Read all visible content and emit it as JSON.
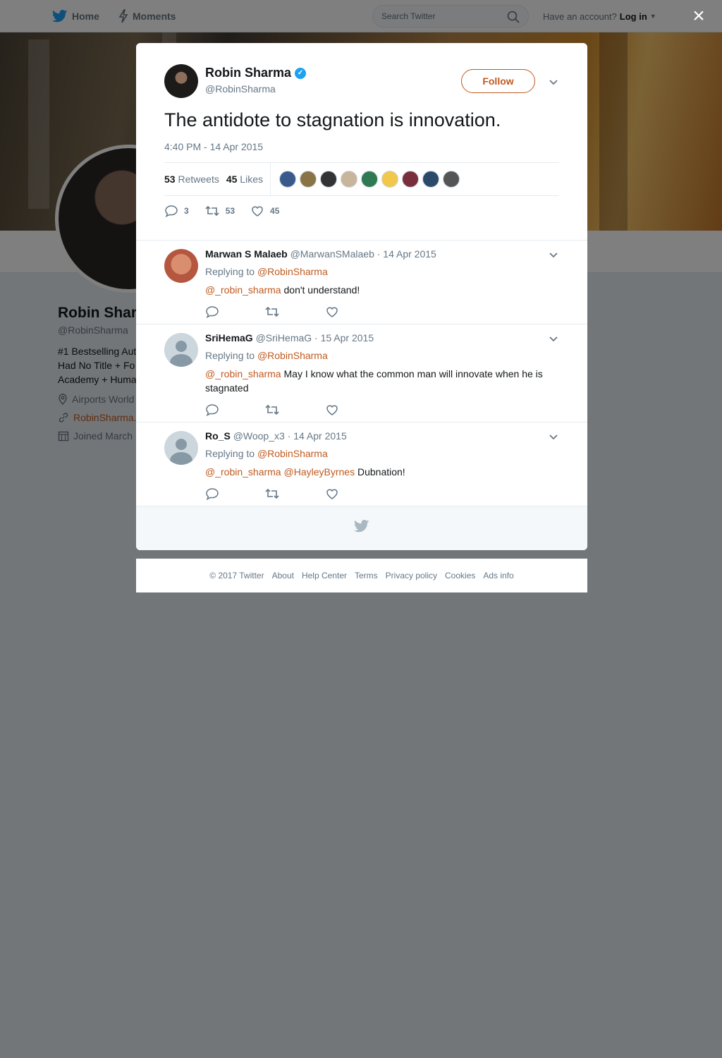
{
  "nav": {
    "home": "Home",
    "moments": "Moments",
    "search_placeholder": "Search Twitter",
    "have_account": "Have an account?",
    "login": "Log in"
  },
  "close_label": "×",
  "profile": {
    "name": "Robin Shar",
    "handle": "@RobinSharma",
    "bio_line1": "#1 Bestselling Aut",
    "bio_line2": "Had No Title + Fo",
    "bio_line3": "Academy + Huma",
    "location": "Airports World",
    "website": "RobinSharma.",
    "joined": "Joined March"
  },
  "tweet": {
    "author_name": "Robin Sharma",
    "author_handle": "@RobinSharma",
    "follow_label": "Follow",
    "text": "The antidote to stagnation is innovation.",
    "time": "4:40 PM - 14 Apr 2015",
    "retweets_count": "53",
    "retweets_label": "Retweets",
    "likes_count": "45",
    "likes_label": "Likes",
    "reply_count": "3",
    "retweet_count": "53",
    "like_count": "45",
    "likers_colors": [
      "#3a5a8c",
      "#8a7445",
      "#333333",
      "#c9b59c",
      "#2f7a52",
      "#f2c84b",
      "#7a2d3a",
      "#2b4a6a",
      "#555555"
    ]
  },
  "replies": [
    {
      "name": "Marwan S Malaeb",
      "handle": "@MarwanSMalaeb",
      "date": "· 14 Apr 2015",
      "replying_prefix": "Replying to",
      "replying_to": "@RobinSharma",
      "mention1": "@_robin_sharma",
      "mention2": "",
      "text": "don't understand!"
    },
    {
      "name": "SriHemaG",
      "handle": "@SriHemaG",
      "date": "· 15 Apr 2015",
      "replying_prefix": "Replying to",
      "replying_to": "@RobinSharma",
      "mention1": "@_robin_sharma",
      "mention2": "",
      "text": "May I know what the common man will innovate when he is stagnated"
    },
    {
      "name": "Ro_S",
      "handle": "@Woop_x3",
      "date": "· 14 Apr 2015",
      "replying_prefix": "Replying to",
      "replying_to": "@RobinSharma",
      "mention1": "@_robin_sharma",
      "mention2": "@HayleyByrnes",
      "text": "Dubnation!"
    }
  ],
  "footer": {
    "copyright": "© 2017 Twitter",
    "about": "About",
    "help": "Help Center",
    "terms": "Terms",
    "privacy": "Privacy policy",
    "cookies": "Cookies",
    "ads": "Ads info"
  }
}
